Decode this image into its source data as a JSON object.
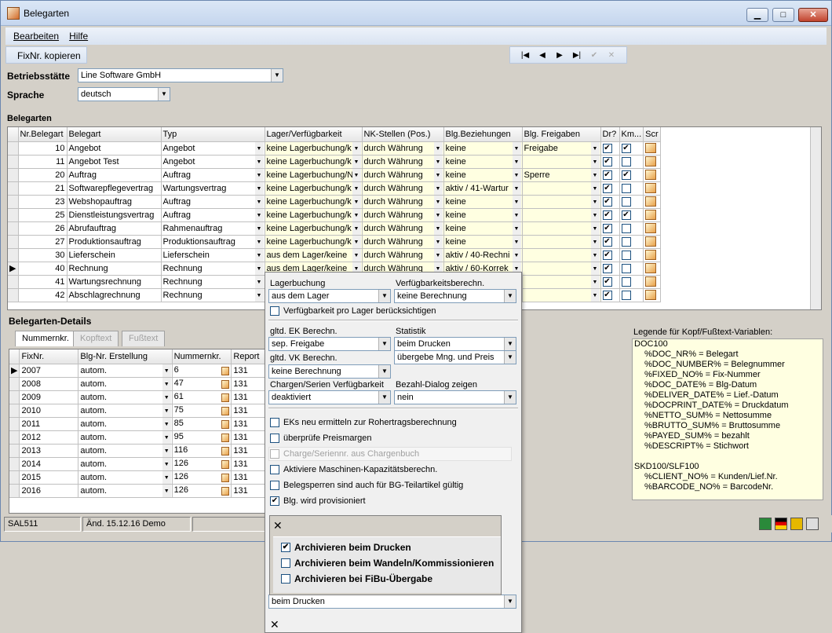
{
  "window": {
    "title": "Belegarten",
    "min": "▁",
    "max": "□",
    "close": "✕"
  },
  "menu": {
    "items": [
      "Bearbeiten",
      "Hilfe"
    ]
  },
  "toolbar": {
    "copy_label": "FixNr. kopieren"
  },
  "nav": {
    "first": "|◀",
    "prev": "◀",
    "next": "▶",
    "last": "▶|",
    "confirm": "✔",
    "cancel": "✕"
  },
  "form": {
    "site_label": "Betriebsstätte",
    "site_value": "Line Software GmbH",
    "lang_label": "Sprache",
    "lang_value": "deutsch"
  },
  "belegarten": {
    "title": "Belegarten",
    "columns": [
      "Nr.Belegart",
      "Belegart",
      "Typ",
      "Lager/Verfügbarkeit",
      "NK-Stellen (Pos.)",
      "Blg.Beziehungen",
      "Blg. Freigaben",
      "Dr?",
      "Km...",
      "Scr"
    ],
    "rows": [
      {
        "nr": "10",
        "name": "Angebot",
        "typ": "Angebot",
        "lager": "keine Lagerbuchung/k",
        "nk": "durch Währung",
        "bez": "keine",
        "frei": "Freigabe",
        "dr": true,
        "km": true
      },
      {
        "nr": "11",
        "name": "Angebot Test",
        "typ": "Angebot",
        "lager": "keine Lagerbuchung/k",
        "nk": "durch Währung",
        "bez": "keine",
        "frei": "",
        "dr": true,
        "km": false
      },
      {
        "nr": "20",
        "name": "Auftrag",
        "typ": "Auftrag",
        "lager": "keine Lagerbuchung/N",
        "nk": "durch Währung",
        "bez": "keine",
        "frei": "Sperre",
        "dr": true,
        "km": true
      },
      {
        "nr": "21",
        "name": "Softwarepflegevertrag",
        "typ": "Wartungsvertrag",
        "lager": "keine Lagerbuchung/k",
        "nk": "durch Währung",
        "bez": "aktiv / 41-Wartur",
        "frei": "",
        "dr": true,
        "km": false
      },
      {
        "nr": "23",
        "name": "Webshopauftrag",
        "typ": "Auftrag",
        "lager": "keine Lagerbuchung/k",
        "nk": "durch Währung",
        "bez": "keine",
        "frei": "",
        "dr": true,
        "km": false
      },
      {
        "nr": "25",
        "name": "Dienstleistungsvertrag",
        "typ": "Auftrag",
        "lager": "keine Lagerbuchung/k",
        "nk": "durch Währung",
        "bez": "keine",
        "frei": "",
        "dr": true,
        "km": true
      },
      {
        "nr": "26",
        "name": "Abrufauftrag",
        "typ": "Rahmenauftrag",
        "lager": "keine Lagerbuchung/k",
        "nk": "durch Währung",
        "bez": "keine",
        "frei": "",
        "dr": true,
        "km": false
      },
      {
        "nr": "27",
        "name": "Produktionsauftrag",
        "typ": "Produktionsauftrag",
        "lager": "keine Lagerbuchung/k",
        "nk": "durch Währung",
        "bez": "keine",
        "frei": "",
        "dr": true,
        "km": false
      },
      {
        "nr": "30",
        "name": "Lieferschein",
        "typ": "Lieferschein",
        "lager": "aus dem Lager/keine",
        "nk": "durch Währung",
        "bez": "aktiv / 40-Rechni",
        "frei": "",
        "dr": true,
        "km": false
      },
      {
        "nr": "40",
        "name": "Rechnung",
        "typ": "Rechnung",
        "lager": "aus dem Lager/keine",
        "nk": "durch Währung",
        "bez": "aktiv / 60-Korrek",
        "frei": "",
        "dr": true,
        "km": false
      },
      {
        "nr": "41",
        "name": "Wartungsrechnung",
        "typ": "Rechnung",
        "lager": "",
        "nk": "",
        "bez": "",
        "frei": "",
        "dr": true,
        "km": false
      },
      {
        "nr": "42",
        "name": "Abschlagrechnung",
        "typ": "Rechnung",
        "lager": "",
        "nk": "",
        "bez": "",
        "frei": "",
        "dr": true,
        "km": false
      }
    ]
  },
  "details": {
    "title": "Belegarten-Details",
    "tabs": [
      "Nummernkr.",
      "Kopftext",
      "Fußtext"
    ],
    "columns": [
      "FixNr.",
      "Blg-Nr. Erstellung",
      "Nummernkr.",
      "Report"
    ],
    "rows": [
      {
        "fix": "2007",
        "erst": "autom.",
        "num": "6",
        "rep": "131"
      },
      {
        "fix": "2008",
        "erst": "autom.",
        "num": "47",
        "rep": "131"
      },
      {
        "fix": "2009",
        "erst": "autom.",
        "num": "61",
        "rep": "131"
      },
      {
        "fix": "2010",
        "erst": "autom.",
        "num": "75",
        "rep": "131"
      },
      {
        "fix": "2011",
        "erst": "autom.",
        "num": "85",
        "rep": "131"
      },
      {
        "fix": "2012",
        "erst": "autom.",
        "num": "95",
        "rep": "131"
      },
      {
        "fix": "2013",
        "erst": "autom.",
        "num": "116",
        "rep": "131"
      },
      {
        "fix": "2014",
        "erst": "autom.",
        "num": "126",
        "rep": "131"
      },
      {
        "fix": "2015",
        "erst": "autom.",
        "num": "126",
        "rep": "131"
      },
      {
        "fix": "2016",
        "erst": "autom.",
        "num": "126",
        "rep": "131"
      }
    ]
  },
  "legend": {
    "title": "Legende für Kopf/Fußtext-Variablen:",
    "lines": [
      {
        "t": "DOC100",
        "h": true
      },
      {
        "t": "%DOC_NR% = Belegart",
        "h": false
      },
      {
        "t": "%DOC_NUMBER% = Belegnummer",
        "h": false
      },
      {
        "t": "%FIXED_NO% = Fix-Nummer",
        "h": false
      },
      {
        "t": "%DOC_DATE% = Blg-Datum",
        "h": false
      },
      {
        "t": "%DELIVER_DATE% = Lief.-Datum",
        "h": false
      },
      {
        "t": "%DOCPRINT_DATE% = Druckdatum",
        "h": false
      },
      {
        "t": "%NETTO_SUM% = Nettosumme",
        "h": false
      },
      {
        "t": "%BRUTTO_SUM% = Bruttosumme",
        "h": false
      },
      {
        "t": "%PAYED_SUM% = bezahlt",
        "h": false
      },
      {
        "t": "%DESCRIPT% = Stichwort",
        "h": false
      },
      {
        "t": "",
        "h": true
      },
      {
        "t": "SKD100/SLF100",
        "h": true
      },
      {
        "t": "%CLIENT_NO% = Kunden/Lief.Nr.",
        "h": false
      },
      {
        "t": "%BARCODE_NO% = BarcodeNr.",
        "h": false
      }
    ]
  },
  "status": {
    "user": "SAL511",
    "change": "Änd. 15.12.16 Demo"
  },
  "popup": {
    "lagerbuchung_label": "Lagerbuchung",
    "lagerbuchung_value": "aus dem Lager",
    "verf_label": "Verfügbarkeitsberechn.",
    "verf_value": "keine Berechnung",
    "pro_lager": "Verfügbarkeit pro Lager berücksichtigen",
    "ek_label": "gltd. EK Berechn.",
    "ek_value": "sep. Freigabe",
    "statistik_label": "Statistik",
    "statistik_value": "beim Drucken",
    "statistik2_value": "übergebe Mng. und Preis",
    "vk_label": "gltd. VK Berechn.",
    "vk_value": "keine Berechnung",
    "chargen_label": "Chargen/Serien Verfügbarkeit",
    "chargen_value": "deaktiviert",
    "bezahl_label": "Bezahl-Dialog zeigen",
    "bezahl_value": "nein",
    "checks": [
      {
        "label": "EKs neu ermitteln zur Rohertragsberechnung",
        "checked": false,
        "disabled": false
      },
      {
        "label": "überprüfe Preismargen",
        "checked": false,
        "disabled": false
      },
      {
        "label": "Charge/Seriennr. aus Chargenbuch",
        "checked": false,
        "disabled": true
      },
      {
        "label": "Aktiviere Maschinen-Kapazitätsberechn.",
        "checked": false,
        "disabled": false
      },
      {
        "label": "Belegsperren sind auch für BG-Teilartikel gültig",
        "checked": false,
        "disabled": false
      },
      {
        "label": "Blg. wird provisioniert",
        "checked": true,
        "disabled": false
      }
    ],
    "bottom_value": "beim Drucken",
    "close_icon": "✕"
  },
  "subpopup": {
    "close_icon": "✕",
    "items": [
      {
        "label": "Archivieren beim Drucken",
        "checked": true
      },
      {
        "label": "Archivieren beim Wandeln/Kommissionieren",
        "checked": false
      },
      {
        "label": "Archivieren bei FiBu-Übergabe",
        "checked": false
      }
    ]
  }
}
